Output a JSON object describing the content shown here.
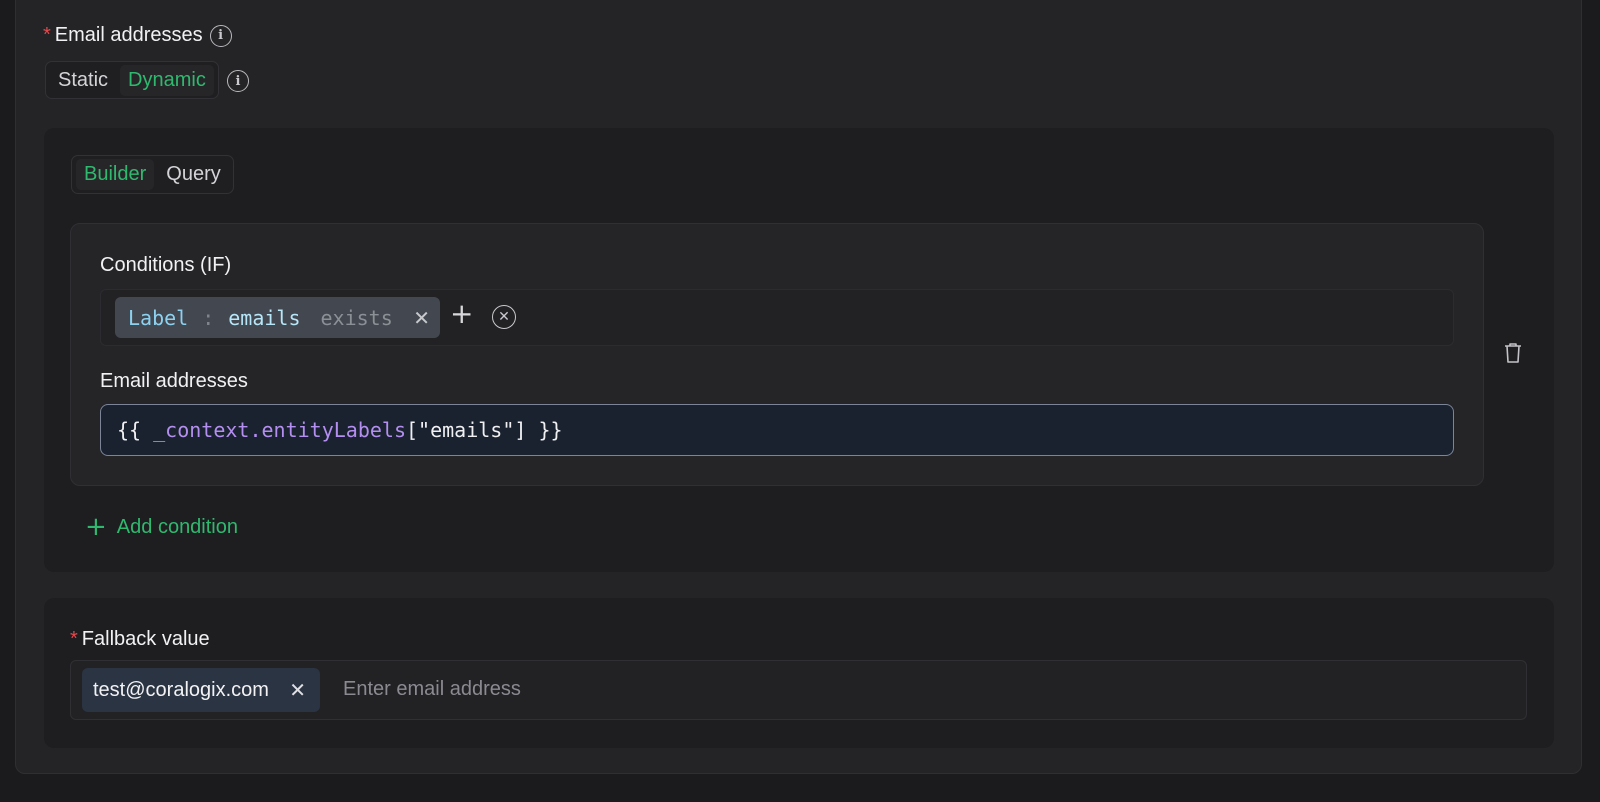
{
  "email_field": {
    "label": "Email addresses",
    "required_marker": "*",
    "mode_tabs": [
      {
        "label": "Static",
        "active": false
      },
      {
        "label": "Dynamic",
        "active": true
      }
    ]
  },
  "builder_tabs": [
    {
      "label": "Builder",
      "active": true
    },
    {
      "label": "Query",
      "active": false
    }
  ],
  "conditions": {
    "title": "Conditions (IF)",
    "chip": {
      "key": "Label",
      "separator": ":",
      "value": "emails",
      "operator": "exists"
    },
    "email_label": "Email addresses",
    "expression": {
      "open": "{{ ",
      "context": "_context.entityLabels",
      "rest": "[\"emails\"] }}"
    }
  },
  "add_condition_label": "Add condition",
  "fallback": {
    "label": "Fallback value",
    "required_marker": "*",
    "chip_value": "test@coralogix.com",
    "placeholder": "Enter email address"
  },
  "colors": {
    "accent_green": "#2fb96f",
    "required_red": "#e5484d",
    "context_purple": "#b48ef0"
  },
  "icons": [
    "info-icon",
    "close-icon",
    "plus-icon",
    "circle-close-icon",
    "trash-icon"
  ]
}
